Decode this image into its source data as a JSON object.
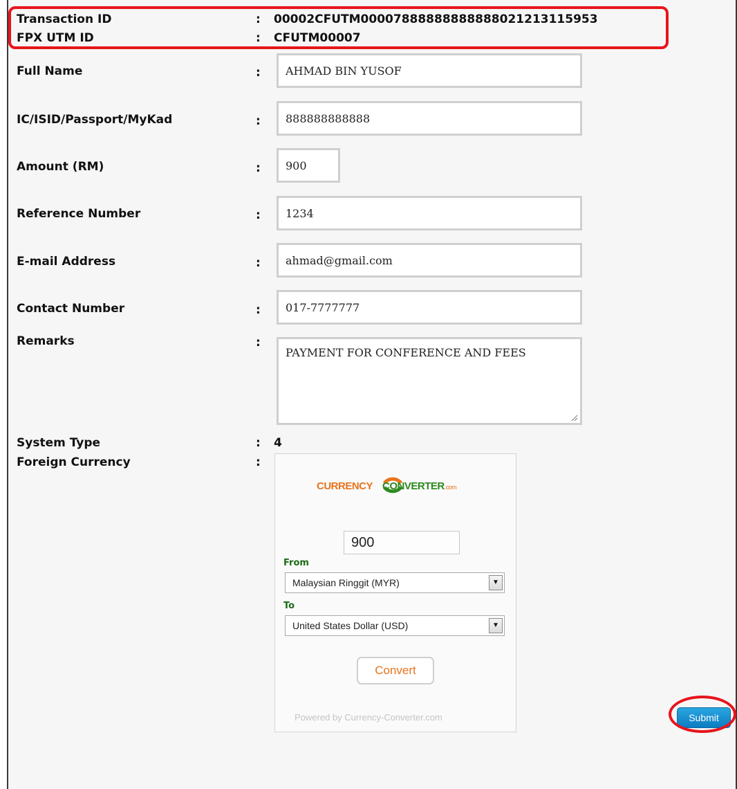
{
  "header": {
    "transaction_id_label": "Transaction ID",
    "transaction_id_value": "00002CFUTM00007888888888888021213115953",
    "fpx_utm_id_label": "FPX UTM ID",
    "fpx_utm_id_value": "CFUTM00007"
  },
  "form": {
    "colon": ":",
    "full_name": {
      "label": "Full Name",
      "value": "AHMAD BIN YUSOF"
    },
    "ic": {
      "label": "IC/ISID/Passport/MyKad",
      "value": "888888888888"
    },
    "amount": {
      "label": "Amount (RM)",
      "value": "900"
    },
    "reference": {
      "label": "Reference Number",
      "value": "1234"
    },
    "email": {
      "label": "E-mail Address",
      "value": "ahmad@gmail.com"
    },
    "contact": {
      "label": "Contact Number",
      "value": "017-7777777"
    },
    "remarks": {
      "label": "Remarks",
      "value": "PAYMENT FOR CONFERENCE AND FEES"
    },
    "system_type": {
      "label": "System Type",
      "value": "4"
    },
    "foreign_currency": {
      "label": "Foreign Currency"
    }
  },
  "currency_converter": {
    "logo_part1": "CURRENCY",
    "logo_part2": "CONVERTER",
    "logo_suffix": ".com",
    "amount": "900",
    "from_label": "From",
    "from_selected": "Malaysian Ringgit (MYR)",
    "to_label": "To",
    "to_selected": "United States Dollar (USD)",
    "convert_label": "Convert",
    "powered_by": "Powered by Currency-Converter.com",
    "colors": {
      "orange": "#e8741c",
      "green": "#2c8a1e"
    }
  },
  "actions": {
    "submit_label": "Submit"
  },
  "annotations": {
    "highlight_color": "#e8141c"
  }
}
